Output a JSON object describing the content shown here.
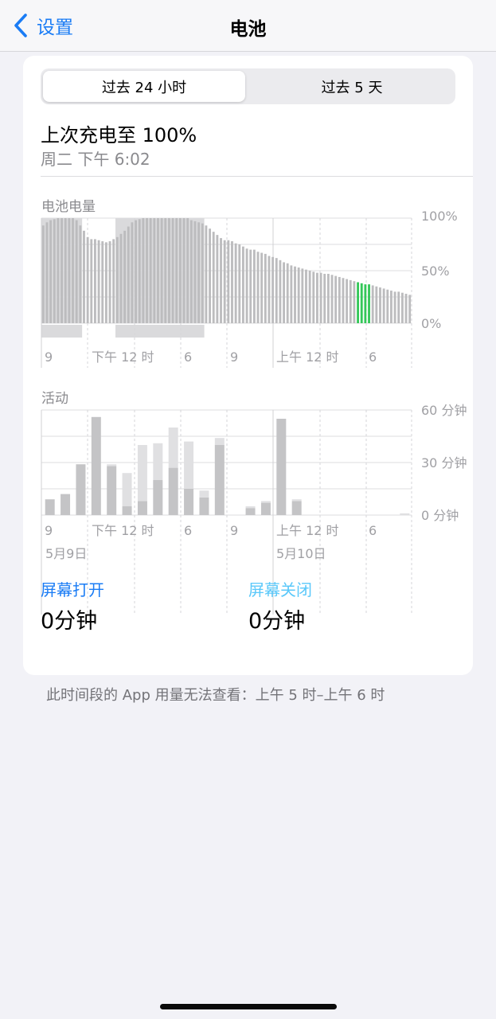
{
  "nav": {
    "back_label": "设置",
    "title": "电池"
  },
  "segments": {
    "selected": "过去 24 小时",
    "other": "过去 5 天"
  },
  "last_charge": {
    "title": "上次充电至 100%",
    "time": "周二 下午 6:02"
  },
  "battery_chart": {
    "label": "电池电量",
    "y_labels": [
      "100%",
      "50%",
      "0%"
    ],
    "x_labels": [
      "9",
      "下午 12 时",
      "6",
      "9",
      "上午 12 时",
      "6"
    ]
  },
  "activity_chart": {
    "label": "活动",
    "y_labels": [
      "60 分钟",
      "30 分钟",
      "0 分钟"
    ],
    "x_labels": [
      "9",
      "下午 12 时",
      "6",
      "9",
      "上午 12 时",
      "6"
    ],
    "date_labels": [
      "5月9日",
      "5月10日"
    ]
  },
  "chart_data": [
    {
      "type": "bar",
      "ylabel": "电池电量",
      "ylim": [
        0,
        100
      ],
      "y_ticks": [
        "0%",
        "50%",
        "100%"
      ],
      "x_ticks": [
        "9",
        "下午 12 时",
        "6",
        "9",
        "上午 12 时",
        "6"
      ],
      "values": [
        93,
        96,
        98,
        99,
        100,
        100,
        100,
        100,
        100,
        98,
        93,
        88,
        82,
        80,
        80,
        79,
        78,
        77,
        78,
        80,
        82,
        85,
        88,
        92,
        96,
        98,
        99,
        100,
        100,
        100,
        100,
        100,
        100,
        100,
        100,
        100,
        100,
        100,
        100,
        100,
        98,
        97,
        96,
        95,
        93,
        90,
        87,
        84,
        81,
        79,
        79,
        78,
        76,
        75,
        73,
        71,
        70,
        70,
        68,
        67,
        66,
        64,
        63,
        62,
        60,
        58,
        57,
        55,
        54,
        53,
        52,
        51,
        50,
        49,
        48,
        48,
        47,
        47,
        46,
        45,
        44,
        43,
        42,
        41,
        40,
        39,
        38,
        37,
        37,
        36,
        35,
        34,
        33,
        32,
        31,
        30,
        30,
        29,
        28,
        27
      ],
      "charging_indices": [
        85,
        86,
        87,
        88
      ],
      "colors": {
        "bar": "#bcbcbe",
        "charging": "#34c759",
        "charging_band": "#dadadc"
      }
    },
    {
      "type": "bar",
      "ylabel": "活动",
      "ylim": [
        0,
        60
      ],
      "y_ticks": [
        "0 分钟",
        "30 分钟",
        "60 分钟"
      ],
      "x_ticks": [
        "9",
        "下午 12 时",
        "6",
        "9",
        "上午 12 时",
        "6"
      ],
      "series": [
        {
          "name": "屏幕打开",
          "values": [
            9,
            12,
            29,
            56,
            28,
            5,
            8,
            20,
            27,
            15,
            10,
            40,
            0,
            4,
            7,
            55,
            8,
            0,
            0,
            0,
            0,
            0,
            0,
            0
          ]
        },
        {
          "name": "屏幕关闭",
          "values": [
            0,
            0,
            0,
            0,
            1,
            19,
            32,
            21,
            23,
            27,
            4,
            4,
            0,
            1,
            1,
            0,
            1,
            0,
            0,
            0,
            0,
            0,
            0,
            1
          ]
        }
      ],
      "colors": {
        "on": "#c4c4c6",
        "off": "#e0e0e2"
      }
    }
  ],
  "stats": {
    "screen_on": {
      "label": "屏幕打开",
      "value": "0分钟",
      "color": "#1a7cf5"
    },
    "screen_off": {
      "label": "屏幕关闭",
      "value": "0分钟",
      "color": "#5ac8fa"
    }
  },
  "footnote": "此时间段的 App 用量无法查看：上午 5 时–上午 6 时"
}
